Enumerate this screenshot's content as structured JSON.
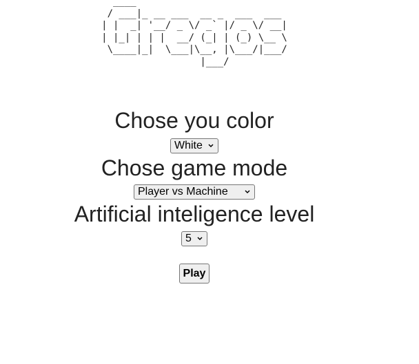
{
  "logo": {
    "ascii": "  ____\n / ___|_ __ ___  __ _  ___  ___\n| |  _| '__/ _ \\/ _` |/ _ \\/ __|\n| |_| | | |  __/ (_| | (_) \\__ \\\n \\____|_|  \\___|\\__, |\\___/|___/\n                 |___/"
  },
  "color_section": {
    "title": "Chose you color",
    "selected": "White"
  },
  "mode_section": {
    "title": "Chose game mode",
    "selected": "Player vs Machine"
  },
  "ai_section": {
    "title": "Artificial inteligence level",
    "selected": "5"
  },
  "play_button": {
    "label": "Play"
  },
  "icons": {
    "select_arrow": "chevron-down-icon"
  }
}
